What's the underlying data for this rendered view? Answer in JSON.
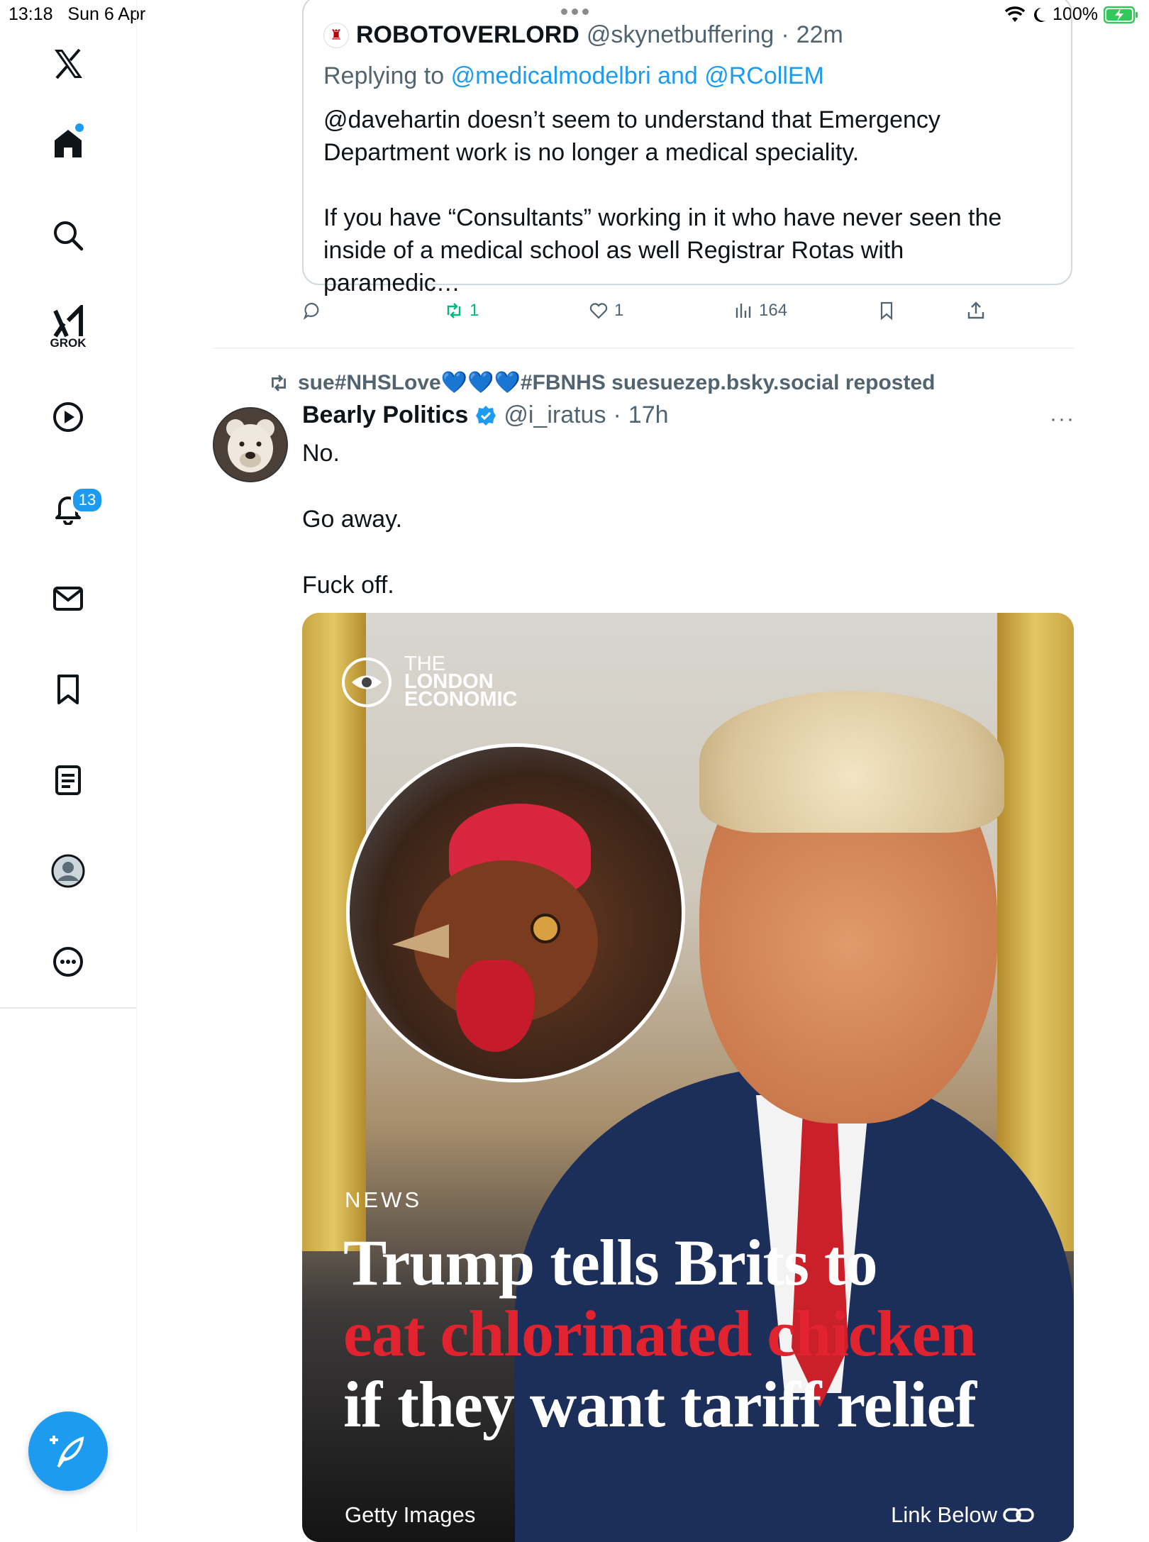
{
  "status_bar": {
    "time": "13:18",
    "date": "Sun 6 Apr",
    "battery": "100%"
  },
  "sidebar": {
    "grok_label": "GROK",
    "notifications_count": "13"
  },
  "quoted_tweet": {
    "name": "ROBOTOVERLORD",
    "handle": "@skynetbuffering",
    "sep": "·",
    "time": "22m",
    "replying_prefix": "Replying to",
    "replying_to": "@medicalmodelbri and @RCollEM",
    "body_1": "@davehartin doesn’t seem to understand that Emergency Department work is no longer a medical speciality.",
    "body_2": "If you have “Consultants” working in it who have never seen the inside of a medical school as well Registrar Rotas with paramedic…",
    "actions": {
      "retweets": "1",
      "likes": "1",
      "views": "164"
    }
  },
  "repost": {
    "user": "sue#NHSLove",
    "hearts": "💙💙💙",
    "rest": "#FBNHS suesuezep.bsky.social reposted"
  },
  "main_tweet": {
    "name": "Bearly Politics",
    "handle": "@i_iratus",
    "sep": "·",
    "time": "17h",
    "more": "···",
    "line_1": "No.",
    "line_2": "Go away.",
    "line_3": "Fuck off.",
    "media": {
      "logo_1": "THE",
      "logo_2": "LONDON",
      "logo_3": "ECONOMIC",
      "section": "NEWS",
      "headline_1": "Trump tells Brits to",
      "headline_2": "eat chlorinated chicken",
      "headline_3": "if they want tariff relief",
      "credit": "Getty Images",
      "link_label": "Link Below"
    }
  },
  "colors": {
    "accent": "#1d9bf0",
    "retweet_green": "#00ba7c",
    "secondary_text": "#536471",
    "headline_red": "#e0232e"
  }
}
